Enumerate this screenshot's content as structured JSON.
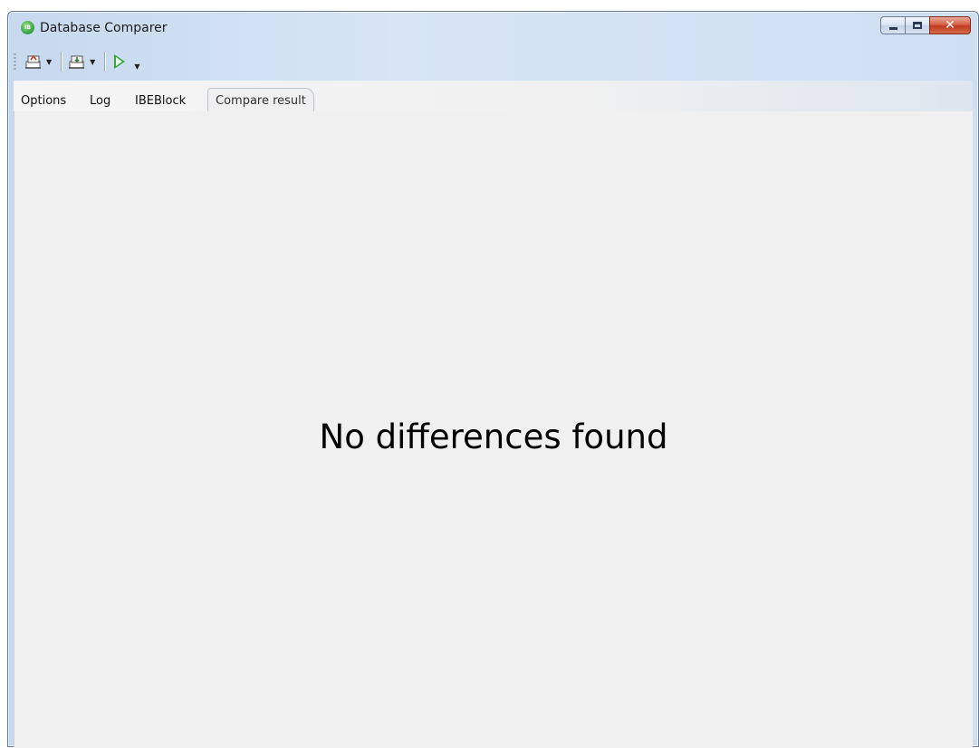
{
  "window": {
    "title": "Database Comparer",
    "app_icon_text": "IB"
  },
  "toolbar": {
    "buttons": [
      {
        "icon": "open-source-db-icon",
        "has_dropdown": true
      },
      {
        "icon": "open-target-db-icon",
        "has_dropdown": true
      },
      {
        "icon": "run-compare-icon",
        "has_dropdown": true
      }
    ],
    "dropdown_glyph": "▼"
  },
  "tabs": [
    {
      "label": "Options",
      "active": false
    },
    {
      "label": "Log",
      "active": false
    },
    {
      "label": "IBEBlock",
      "active": false
    },
    {
      "label": "Compare result",
      "active": true
    }
  ],
  "compare_result": {
    "message": "No differences found"
  },
  "colors": {
    "content_bg": "#f0f0f0",
    "frame_blue": "#c7d9ef",
    "close_red": "#c03a1e",
    "run_green": "#3aa63a"
  }
}
